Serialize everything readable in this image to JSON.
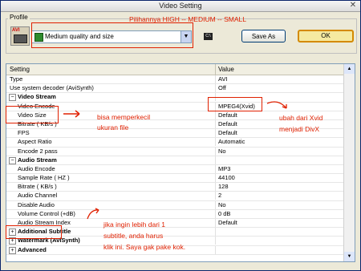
{
  "window": {
    "title": "Video Setting",
    "close_glyph": "✕"
  },
  "profile": {
    "label": "Profile",
    "icon_text": "AVI",
    "selected": "Medium quality and size",
    "save_as": "Save As",
    "ok": "OK"
  },
  "grid": {
    "col_setting": "Setting",
    "col_value": "Value",
    "rows": [
      {
        "k": "Type",
        "v": "AVI",
        "kind": "plain"
      },
      {
        "k": "Use system decoder (AviSynth)",
        "v": "Off",
        "kind": "plain"
      },
      {
        "k": "Video Stream",
        "v": "",
        "kind": "cat",
        "tog": "−"
      },
      {
        "k": "Video Encode",
        "v": "MPEG4(Xvid)",
        "kind": "sub"
      },
      {
        "k": "Video Size",
        "v": "Default",
        "kind": "sub"
      },
      {
        "k": "Bitrate ( KB/s )",
        "v": "Default",
        "kind": "sub"
      },
      {
        "k": "FPS",
        "v": "Default",
        "kind": "sub"
      },
      {
        "k": "Aspect Ratio",
        "v": "Automatic",
        "kind": "sub"
      },
      {
        "k": "Encode 2 pass",
        "v": "No",
        "kind": "sub"
      },
      {
        "k": "Audio Stream",
        "v": "",
        "kind": "cat",
        "tog": "−"
      },
      {
        "k": "Audio Encode",
        "v": "MP3",
        "kind": "sub"
      },
      {
        "k": "Sample Rate ( HZ )",
        "v": "44100",
        "kind": "sub"
      },
      {
        "k": "Bitrate ( KB/s )",
        "v": "128",
        "kind": "sub"
      },
      {
        "k": "Audio Channel",
        "v": "2",
        "kind": "sub"
      },
      {
        "k": "Disable Audio",
        "v": "No",
        "kind": "sub"
      },
      {
        "k": "Volume Control (+dB)",
        "v": "0 dB",
        "kind": "sub"
      },
      {
        "k": "Audio Stream Index",
        "v": "Default",
        "kind": "sub"
      },
      {
        "k": "Additional Subtitle",
        "v": "",
        "kind": "cat",
        "tog": "+"
      },
      {
        "k": "Watermark (AviSynth)",
        "v": "",
        "kind": "cat",
        "tog": "+"
      },
      {
        "k": "Advanced",
        "v": "",
        "kind": "cat",
        "tog": "+"
      }
    ]
  },
  "annotations": {
    "profile_note": "Pilihannya  HIGH -- MEDIUM -- SMALL",
    "size_note_1": "bisa memperkecil",
    "size_note_2": "ukuran file",
    "encode_note_1": "ubah dari Xvid",
    "encode_note_2": "menjadi DivX",
    "subtitle_note_1": "jika ingin lebih dari 1",
    "subtitle_note_2": "subtitle, anda harus",
    "subtitle_note_3": "klik ini. Saya gak pake kok."
  },
  "colors": {
    "annotation": "#e02000",
    "ok_button": "#f5e9a0",
    "title_bar": "#e8e8e8"
  }
}
